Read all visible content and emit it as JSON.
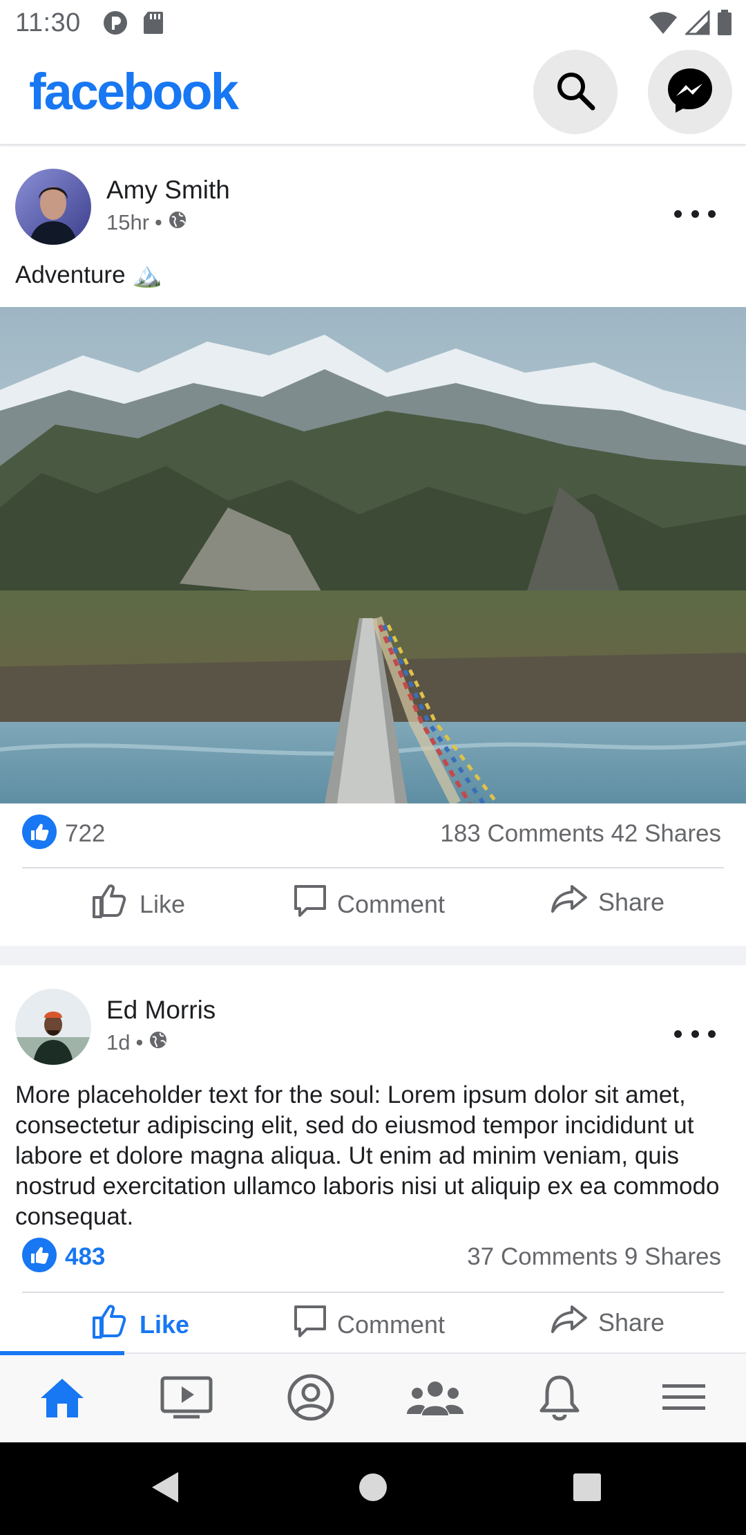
{
  "status_bar": {
    "time": "11:30",
    "left_icons": [
      "pocket-icon",
      "sd-card-icon"
    ],
    "right_icons": [
      "wifi-icon",
      "cellular-icon",
      "battery-icon"
    ]
  },
  "header": {
    "logo": "facebook",
    "buttons": [
      "search-icon",
      "messenger-icon"
    ],
    "brand_color": "#1877f2"
  },
  "posts": [
    {
      "author": "Amy Smith",
      "time": "15hr",
      "visibility": "globe-icon",
      "text": "Adventure 🏔️",
      "has_image": true,
      "image_description_icon": "mountain-bridge-photo",
      "likes": "722",
      "liked": false,
      "comments": "183 Comments",
      "shares": "42 Shares",
      "actions": {
        "like": "Like",
        "comment": "Comment",
        "share": "Share"
      }
    },
    {
      "author": "Ed Morris",
      "time": "1d",
      "visibility": "globe-icon",
      "text": "More placeholder text for the soul: Lorem ipsum dolor sit amet, consectetur adipiscing elit, sed do eiusmod tempor incididunt ut labore et dolore magna aliqua. Ut enim ad minim veniam, quis nostrud exercitation ullamco laboris nisi ut aliquip ex ea commodo consequat.",
      "has_image": false,
      "likes": "483",
      "liked": true,
      "comments": "37 Comments",
      "shares": "9 Shares",
      "actions": {
        "like": "Like",
        "comment": "Comment",
        "share": "Share"
      }
    }
  ],
  "bottom_nav": {
    "items": [
      "home-icon",
      "video-icon",
      "profile-icon",
      "groups-icon",
      "notifications-icon",
      "menu-icon"
    ],
    "active": "home-icon"
  },
  "system_nav": [
    "back-icon",
    "home-circle-icon",
    "recents-icon"
  ]
}
